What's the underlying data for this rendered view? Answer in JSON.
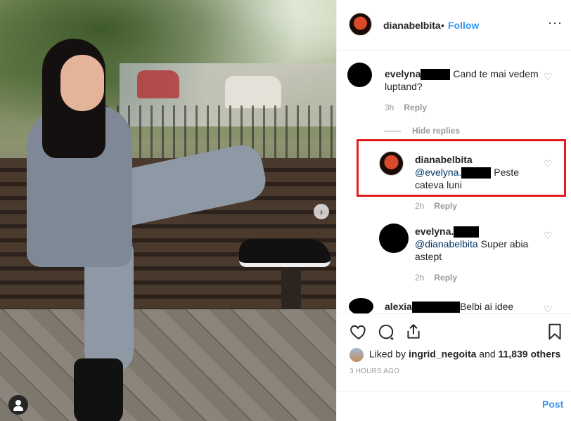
{
  "post": {
    "username": "dianabelbita",
    "separator": "•",
    "follow_label": "Follow",
    "more_label": "···"
  },
  "photo": {
    "next_arrow": "›"
  },
  "comments": [
    {
      "user": "evelyna",
      "text": "Cand te mai vedem luptand?",
      "age": "3h",
      "reply_label": "Reply"
    },
    {
      "user": "dianabelbita",
      "mention": "@evelyna.",
      "text": "Peste cateva luni",
      "age": "2h",
      "reply_label": "Reply"
    },
    {
      "user": "evelyna.",
      "mention": "@dianabelbita",
      "text": "Super abia astept",
      "age": "2h",
      "reply_label": "Reply"
    },
    {
      "user": "alexia",
      "text": "Belbi ai idee"
    }
  ],
  "hide_replies_label": "Hide replies",
  "likes": {
    "prefix": "Liked by",
    "liker": "ingrid_negoita",
    "joiner": "and",
    "count": "11,839 others"
  },
  "timestamp": "3 HOURS AGO",
  "post_button": "Post",
  "icons": [
    "heart-icon",
    "comment-icon",
    "share-icon",
    "bookmark-icon",
    "user-tag-icon"
  ],
  "colors": {
    "link_blue": "#3897f0",
    "highlight_red": "#e02020"
  }
}
